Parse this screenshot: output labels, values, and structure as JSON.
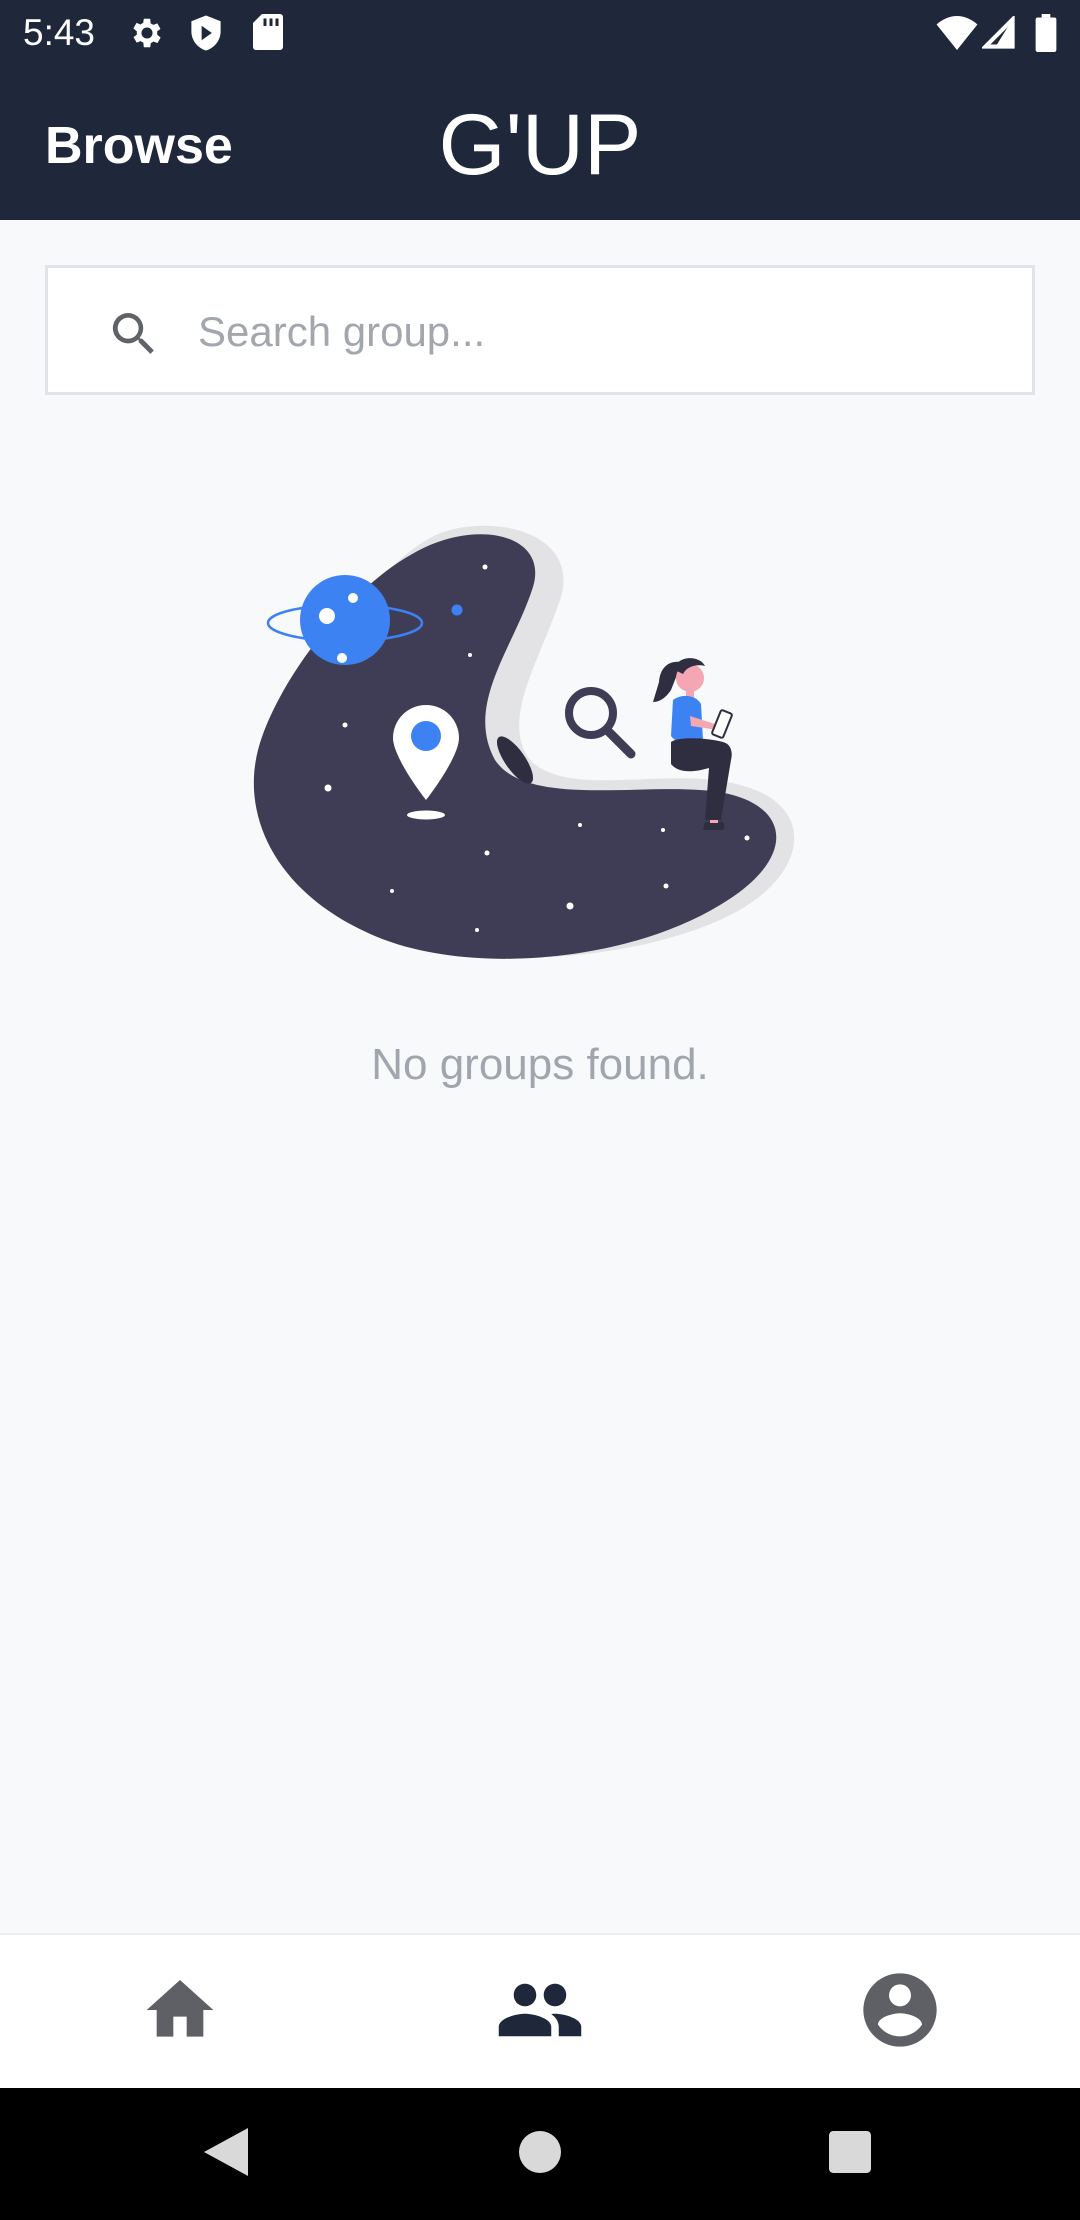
{
  "status_bar": {
    "time": "5:43",
    "icons_left": [
      "gear-icon",
      "shield-icon",
      "sd-card-icon"
    ],
    "icons_right": [
      "wifi-icon",
      "signal-icon",
      "battery-icon"
    ]
  },
  "header": {
    "browse_label": "Browse",
    "app_title": "G'UP",
    "background": "#1f283a"
  },
  "search": {
    "placeholder": "Search group...",
    "value": ""
  },
  "empty_state": {
    "message": "No groups found.",
    "accent_color": "#3d82f2"
  },
  "bottom_nav": {
    "items": [
      {
        "icon": "home-icon",
        "active": false
      },
      {
        "icon": "groups-icon",
        "active": true
      },
      {
        "icon": "account-icon",
        "active": false
      }
    ]
  },
  "system_nav": {
    "items": [
      "back-icon",
      "home-circle-icon",
      "recents-icon"
    ]
  }
}
